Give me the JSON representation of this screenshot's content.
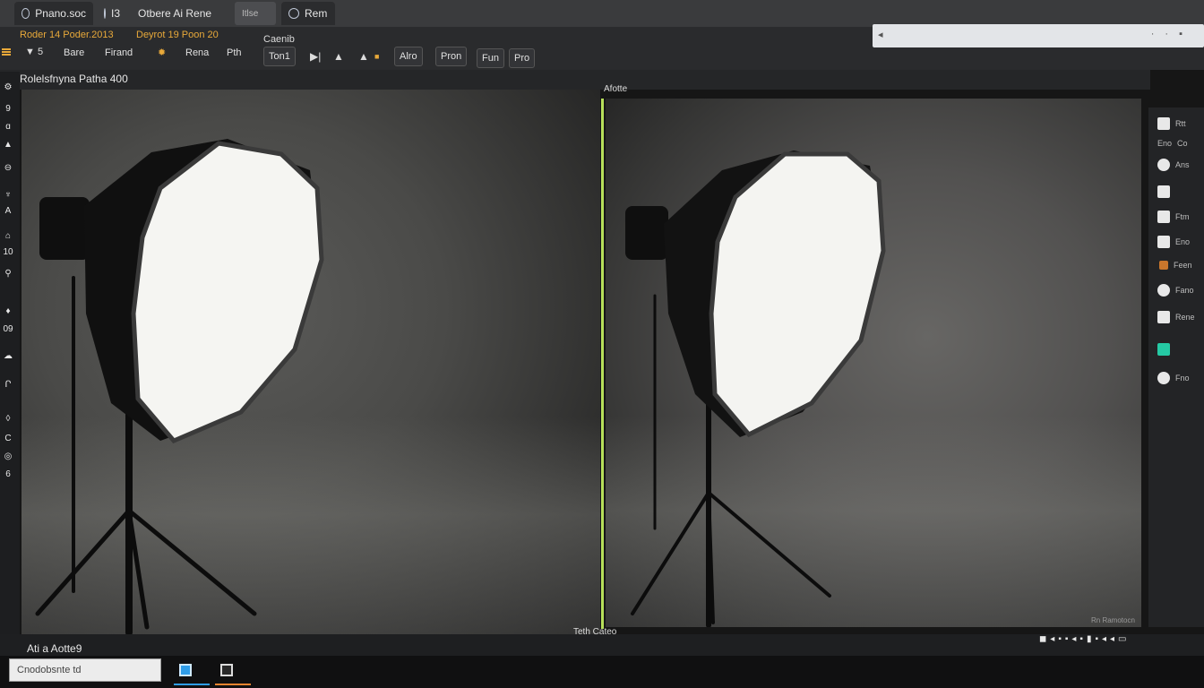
{
  "tabs": [
    {
      "label": "Pnano.soc"
    },
    {
      "label": "I3"
    },
    {
      "label": "Otbere  Ai Rene"
    },
    {
      "label": "Itlse"
    },
    {
      "label": "Rem"
    }
  ],
  "toolbar": {
    "row1": [
      "Roder 14  Poder.2013",
      "Deyrot 19 Poon 20"
    ],
    "group_label": "Caenib",
    "row2": [
      "5",
      "Bare",
      "Firand",
      "Rena",
      "Pth"
    ],
    "buttons": [
      "Ton1",
      "Alro",
      "Pron",
      "Fun",
      "Pro"
    ]
  },
  "panel": {
    "title": "Rolelsfnyna Patha 400",
    "right_header": "Afotte"
  },
  "rail": [
    "9",
    "A",
    "G",
    "A",
    "10",
    "09",
    "C",
    "6"
  ],
  "right_panel": [
    "Rtt",
    "Eno",
    "Co",
    "Ans",
    "Ftm",
    "Eno",
    "Feen",
    "Fano",
    "Rene",
    "Fno"
  ],
  "status": {
    "left": "Ati a Aotte9",
    "mid": "Teth Cateo",
    "right": "Rn Ramotocn"
  },
  "taskbar": {
    "search_text": "Cnodobsnte td"
  },
  "colors": {
    "accent": "#b7e05a",
    "toolbar_orange": "#e8a93a",
    "taskbar_blue": "#2f9de8"
  }
}
